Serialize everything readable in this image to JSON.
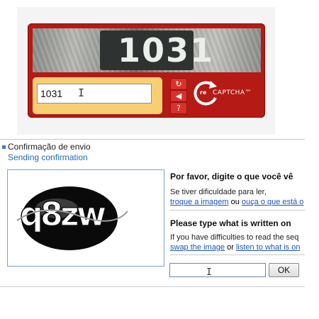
{
  "recaptcha": {
    "challenge_text": "1031",
    "input_value": "1031",
    "controls": [
      {
        "icon": "refresh-icon",
        "glyph": "↻"
      },
      {
        "icon": "audio-icon",
        "glyph": "◀"
      },
      {
        "icon": "help-icon",
        "glyph": "?"
      }
    ],
    "logo_re": "re",
    "logo_text": "CAPTCHA™"
  },
  "confirmation": {
    "title": "Confirmação de envio",
    "subtitle": "Sending confirmation",
    "challenge_text": "q8zw",
    "pt": {
      "heading": "Por favor, digite o que você vê na",
      "help_text": "Se tiver dificuldade para ler,",
      "link_swap": "troque a imagem",
      "or": "ou",
      "link_listen": "ouça o que está o"
    },
    "en": {
      "heading": "Please type what is written on the",
      "help_text": "If you have difficulties to read the seq",
      "link_swap": "swap the image",
      "or": "or",
      "link_listen": "listen to what is on"
    },
    "answer_value": "",
    "ok_label": "OK"
  },
  "colors": {
    "recaptcha_red": "#b51a14",
    "input_highlight": "#f7cf73",
    "link_blue": "#1a55b6",
    "section_blue": "#3d7ec9"
  }
}
